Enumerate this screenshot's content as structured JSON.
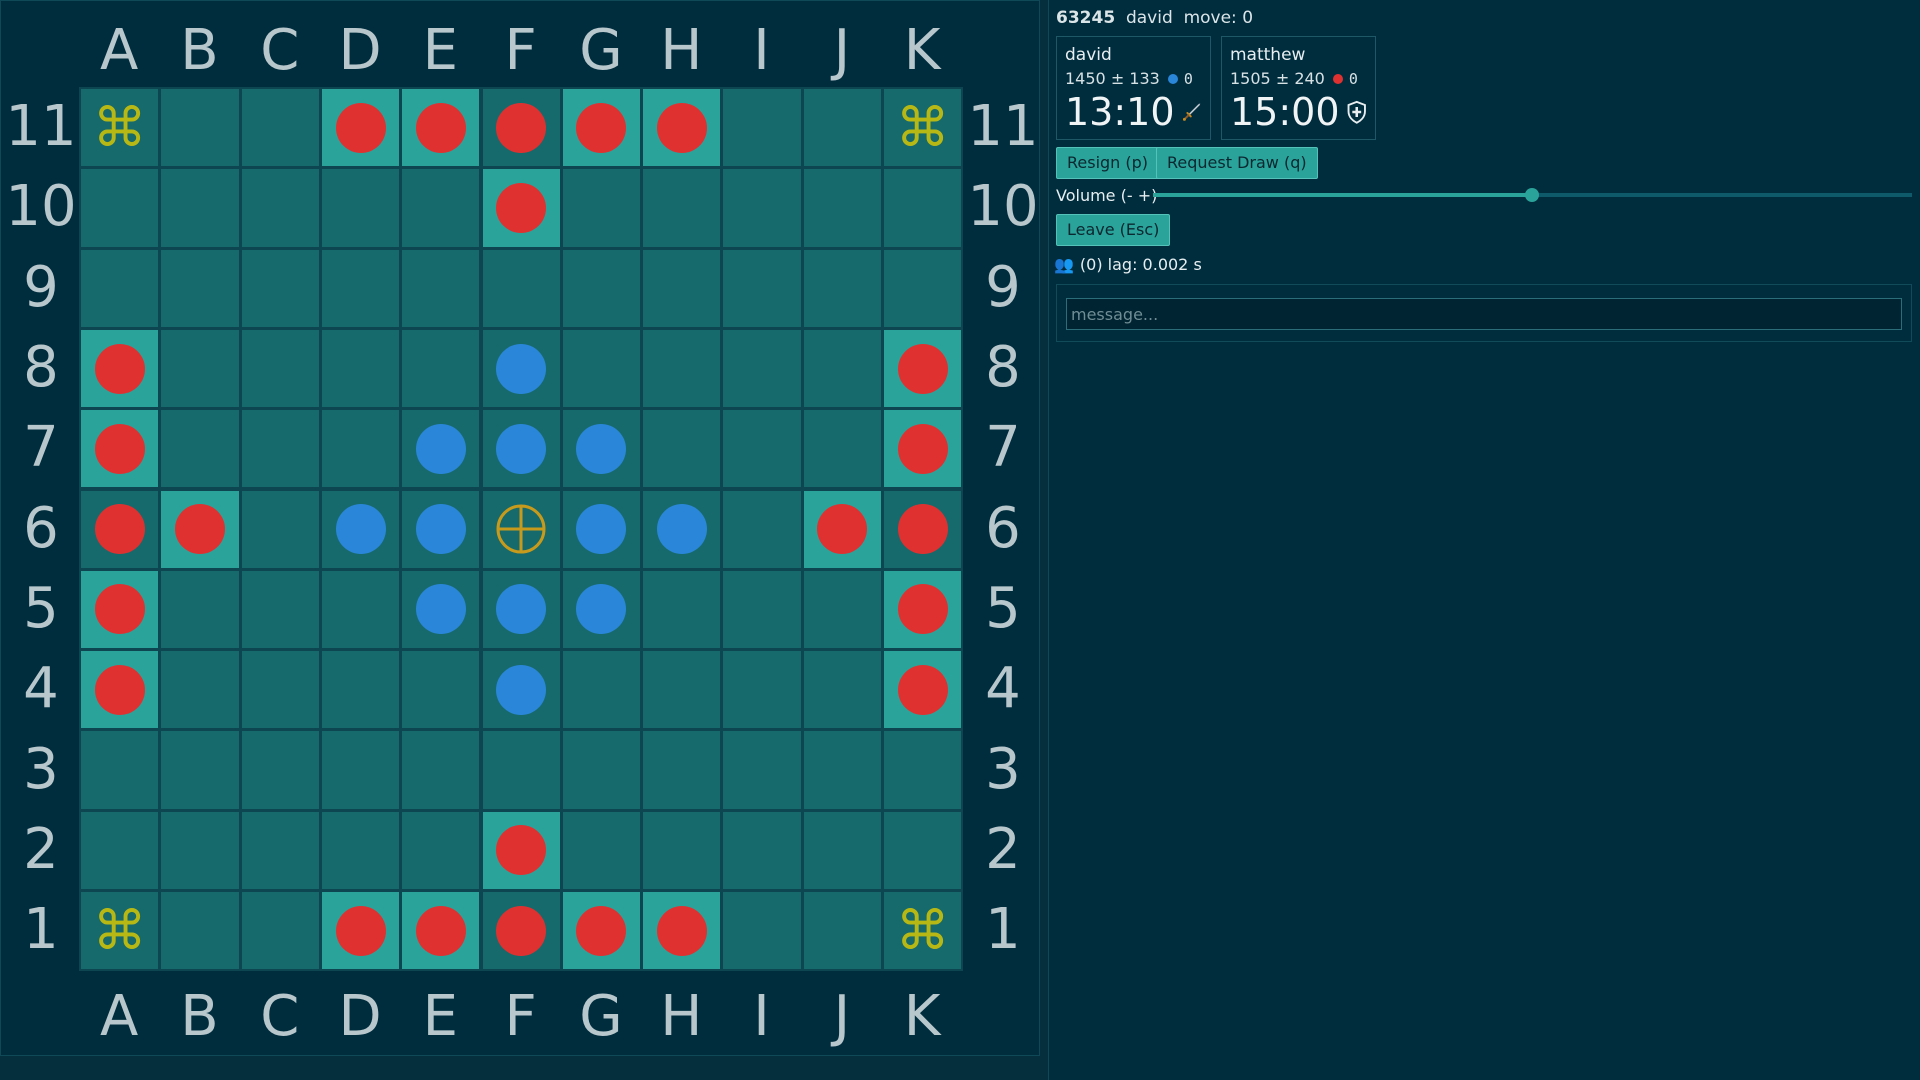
{
  "board": {
    "files": [
      "A",
      "B",
      "C",
      "D",
      "E",
      "F",
      "G",
      "H",
      "I",
      "J",
      "K"
    ],
    "ranks": [
      "11",
      "10",
      "9",
      "8",
      "7",
      "6",
      "5",
      "4",
      "3",
      "2",
      "1"
    ],
    "highlighted": [
      "d11",
      "e11",
      "g11",
      "h11",
      "f10",
      "a8",
      "k8",
      "a7",
      "k7",
      "b6",
      "j6",
      "a5",
      "k5",
      "a4",
      "k4",
      "f2",
      "d1",
      "e1",
      "g1",
      "h1"
    ],
    "corners": [
      "a11",
      "k11",
      "a1",
      "k1"
    ],
    "corner_glyph": "⌘",
    "throne": "f6",
    "red": [
      "d11",
      "e11",
      "f11",
      "g11",
      "h11",
      "f10",
      "a8",
      "k8",
      "a7",
      "k7",
      "a6",
      "b6",
      "j6",
      "k6",
      "a5",
      "k5",
      "a4",
      "k4",
      "f2",
      "d1",
      "e1",
      "f1",
      "g1",
      "h1"
    ],
    "blue": [
      "f8",
      "e7",
      "f7",
      "g7",
      "d6",
      "e6",
      "g6",
      "h6",
      "e5",
      "f5",
      "g5",
      "f4"
    ],
    "colors": {
      "red": "#e03131",
      "blue": "#2a86d8",
      "cell": "#176a6b",
      "highlight": "#2aa39a",
      "corner": "#b8b814",
      "throne": "#c89a1c"
    }
  },
  "header": {
    "game_id": "63245",
    "user": "david",
    "move_label": "move: 0"
  },
  "players": [
    {
      "name": "david",
      "rating": "1450",
      "pm": "±",
      "dev": "133",
      "color": "#2a86d8",
      "captures": "0",
      "clock": "13:10",
      "icon": "sword-icon"
    },
    {
      "name": "matthew",
      "rating": "1505",
      "pm": "±",
      "dev": "240",
      "color": "#e03131",
      "captures": "0",
      "clock": "15:00",
      "icon": "shield-icon"
    }
  ],
  "controls": {
    "resign": "Resign (p)",
    "draw": "Request Draw (q)",
    "volume_label": "Volume (- +)",
    "volume_level": 0.5,
    "leave": "Leave (Esc)"
  },
  "status": {
    "lag_text": "(0) lag: 0.002 s"
  },
  "chat": {
    "placeholder": "message..."
  }
}
